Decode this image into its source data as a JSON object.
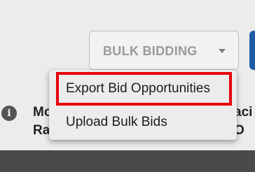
{
  "toolbar": {
    "bulk_bidding_label": "BULK BIDDING",
    "accent_color": "#1f5aa6"
  },
  "dropdown": {
    "items": [
      {
        "label": "Export Bid Opportunities",
        "highlighted": true
      },
      {
        "label": "Upload Bulk Bids",
        "highlighted": false
      }
    ],
    "highlight_color": "#e8000b"
  },
  "background_row": {
    "info_icon_glyph": "i",
    "left_line1": "Mo",
    "left_line2": "Ra",
    "right_line1": "aci",
    "right_line2": "O"
  }
}
